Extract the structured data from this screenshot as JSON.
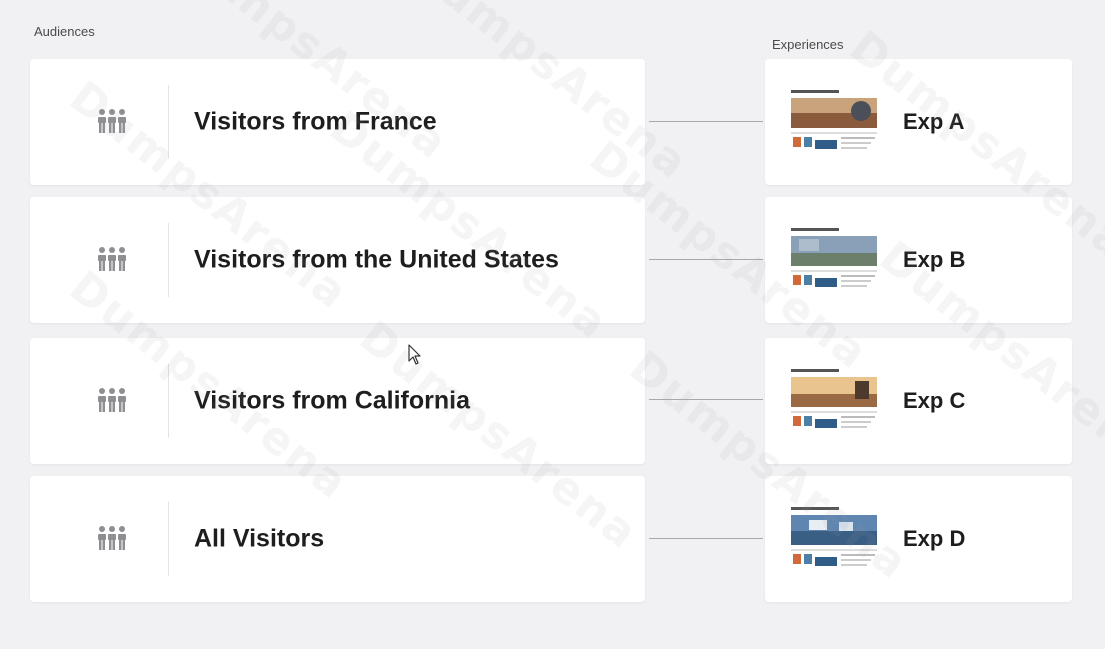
{
  "labels": {
    "audiences": "Audiences",
    "experiences": "Experiences"
  },
  "audiences": [
    {
      "label": "Visitors from France",
      "icon": "people-icon"
    },
    {
      "label": "Visitors from the United States",
      "icon": "people-icon"
    },
    {
      "label": "Visitors from California",
      "icon": "people-icon"
    },
    {
      "label": "All Visitors",
      "icon": "people-icon"
    }
  ],
  "experiences": [
    {
      "label": "Exp A",
      "thumbnail": "exp-thumbnail-image"
    },
    {
      "label": "Exp B",
      "thumbnail": "exp-thumbnail-image"
    },
    {
      "label": "Exp C",
      "thumbnail": "exp-thumbnail-image"
    },
    {
      "label": "Exp D",
      "thumbnail": "exp-thumbnail-image"
    }
  ],
  "watermark": "DumpsArena",
  "colors": {
    "background": "#f1f1f3",
    "card": "#ffffff",
    "icon": "#8e8e93",
    "connector": "#a8a8ac"
  }
}
